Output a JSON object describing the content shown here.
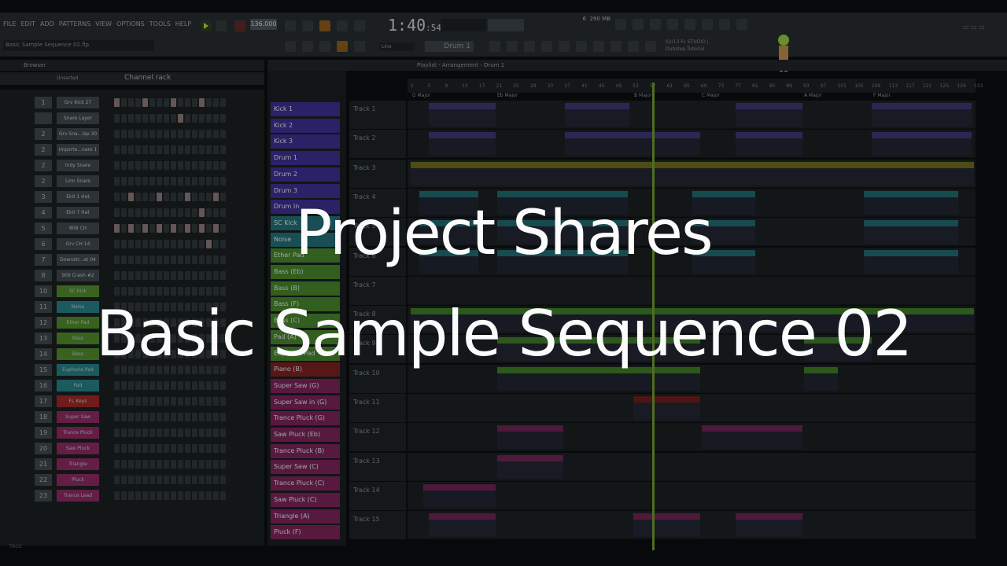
{
  "menu": [
    "FILE",
    "EDIT",
    "ADD",
    "PATTERNS",
    "VIEW",
    "OPTIONS",
    "TOOLS",
    "HELP"
  ],
  "project_file": "Basic Sample Sequence 02.flp",
  "tempo": "136.000",
  "time": {
    "main": "1:40",
    "sub": ":54",
    "unit": "B:S:T"
  },
  "memory": "290 MB",
  "cpu": "6",
  "snap": "Line",
  "pattern_name": "Drum 1",
  "news": [
    "02/13 FL STUDIO |",
    "Dubstep Tutorial"
  ],
  "browser": {
    "title": "Browser",
    "sort": "Unsorted"
  },
  "channel_rack": {
    "title": "Channel rack",
    "rows": [
      {
        "n": "1",
        "name": "Grv Kick 27",
        "color": "#3e464a"
      },
      {
        "n": "",
        "name": "Snare Layer",
        "color": "#3e464a"
      },
      {
        "n": "2",
        "name": "Grv Sna...lap 30",
        "color": "#3e464a"
      },
      {
        "n": "2",
        "name": "Importe...nare 1",
        "color": "#3e464a"
      },
      {
        "n": "2",
        "name": "Indy Snare",
        "color": "#3e464a"
      },
      {
        "n": "2",
        "name": "Linn Snare",
        "color": "#3e464a"
      },
      {
        "n": "3",
        "name": "Ekit 1 Hat",
        "color": "#3e464a"
      },
      {
        "n": "4",
        "name": "Ekit 7 Hat",
        "color": "#3e464a"
      },
      {
        "n": "5",
        "name": "808 CH",
        "color": "#3e464a"
      },
      {
        "n": "6",
        "name": "Grv CH 14",
        "color": "#3e464a"
      },
      {
        "n": "7",
        "name": "Downstr...at 04",
        "color": "#3e464a"
      },
      {
        "n": "8",
        "name": "909 Crash #2",
        "color": "#3e464a"
      },
      {
        "n": "10",
        "name": "SC Kick",
        "color": "#4e8a2c"
      },
      {
        "n": "11",
        "name": "Noise",
        "color": "#267f86"
      },
      {
        "n": "12",
        "name": "Ether Pad",
        "color": "#4e8a2c"
      },
      {
        "n": "13",
        "name": "Bass",
        "color": "#4e8a2c"
      },
      {
        "n": "14",
        "name": "Bass",
        "color": "#4e8a2c"
      },
      {
        "n": "15",
        "name": "Euphoria Pad",
        "color": "#267f86"
      },
      {
        "n": "16",
        "name": "Pad",
        "color": "#267f86"
      },
      {
        "n": "17",
        "name": "FL Keys",
        "color": "#9b2828"
      },
      {
        "n": "18",
        "name": "Super Saw",
        "color": "#8b2a62"
      },
      {
        "n": "19",
        "name": "Trance Pluck",
        "color": "#8b2a62"
      },
      {
        "n": "20",
        "name": "Saw Pluck",
        "color": "#8b2a62"
      },
      {
        "n": "21",
        "name": "Triangle",
        "color": "#8b2a62"
      },
      {
        "n": "22",
        "name": "Pluck",
        "color": "#8b2a62"
      },
      {
        "n": "23",
        "name": "Trance Lead",
        "color": "#8b2a62"
      }
    ]
  },
  "tags_label": "TAGS",
  "playlist": {
    "title": "Playlist - Arrangement - Drum 1",
    "keys": [
      "G Major",
      "Eb Major",
      "B Major",
      "C Major",
      "A Major",
      "F Major"
    ],
    "ruler": [
      "1",
      "5",
      "9",
      "13",
      "17",
      "21",
      "25",
      "29",
      "33",
      "37",
      "41",
      "45",
      "49",
      "53",
      "57",
      "61",
      "65",
      "69",
      "73",
      "77",
      "81",
      "85",
      "89",
      "93",
      "97",
      "101",
      "105",
      "109",
      "113",
      "117",
      "121",
      "125",
      "129",
      "133"
    ],
    "tracks": [
      "Track 1",
      "Track 2",
      "Track 3",
      "Track 4",
      "Track 5",
      "Track 6",
      "Track 7",
      "Track 8",
      "Track 9",
      "Track 10",
      "Track 11",
      "Track 12",
      "Track 13",
      "Track 14",
      "Track 15"
    ],
    "clips": [
      {
        "name": "Kick 1",
        "color": "#3b2f8e"
      },
      {
        "name": "Kick 2",
        "color": "#3b2f8e"
      },
      {
        "name": "Kick 3",
        "color": "#3b2f8e"
      },
      {
        "name": "Drum 1",
        "color": "#3b2f8e"
      },
      {
        "name": "Drum 2",
        "color": "#3b2f8e"
      },
      {
        "name": "Drum 3",
        "color": "#3b2f8e"
      },
      {
        "name": "Drum In",
        "color": "#3b2f8e"
      },
      {
        "name": "SC Kick",
        "color": "#226d75"
      },
      {
        "name": "Noise",
        "color": "#226d75"
      },
      {
        "name": "Ether Pad",
        "color": "#46832b"
      },
      {
        "name": "Bass (Eb)",
        "color": "#46832b"
      },
      {
        "name": "Bass (B)",
        "color": "#46832b"
      },
      {
        "name": "Bass (F)",
        "color": "#46832b"
      },
      {
        "name": "Bass (C)",
        "color": "#46832b"
      },
      {
        "name": "Pad (A)",
        "color": "#46832b"
      },
      {
        "name": "Euphoria Pad",
        "color": "#46832b"
      },
      {
        "name": "Piano (B)",
        "color": "#7a2020"
      },
      {
        "name": "Super Saw (G)",
        "color": "#7a2358"
      },
      {
        "name": "Super Saw in (G)",
        "color": "#7a2358"
      },
      {
        "name": "Trance Pluck (G)",
        "color": "#7a2358"
      },
      {
        "name": "Saw Pluck (Eb)",
        "color": "#7a2358"
      },
      {
        "name": "Trance Pluck (B)",
        "color": "#7a2358"
      },
      {
        "name": "Super Saw (C)",
        "color": "#7a2358"
      },
      {
        "name": "Trance Pluck (C)",
        "color": "#7a2358"
      },
      {
        "name": "Saw Pluck (C)",
        "color": "#7a2358"
      },
      {
        "name": "Triangle (A)",
        "color": "#7a2358"
      },
      {
        "name": "Pluck (F)",
        "color": "#7a2358"
      }
    ]
  },
  "overlay": {
    "line1": "Project Shares",
    "line2": "Basic Sample Sequence 02"
  }
}
